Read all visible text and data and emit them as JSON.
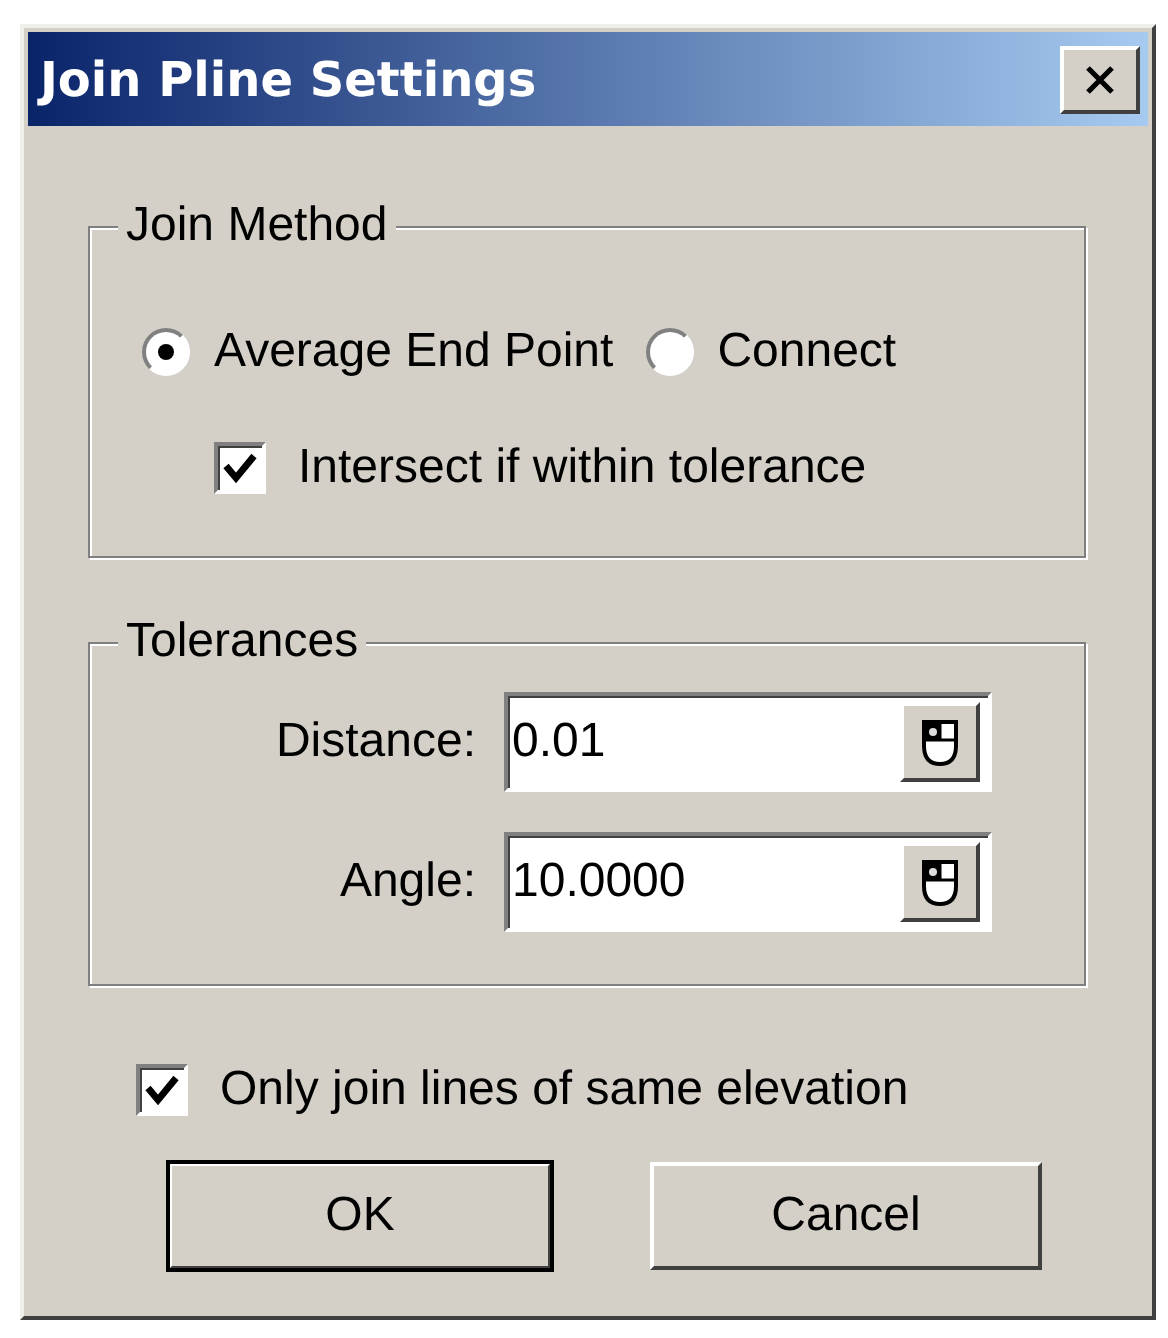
{
  "window": {
    "title": "Join Pline Settings"
  },
  "join_method": {
    "title": "Join Method",
    "options": [
      {
        "label": "Average End Point",
        "selected": true
      },
      {
        "label": "Connect",
        "selected": false
      }
    ],
    "intersect": {
      "label": "Intersect if within tolerance",
      "checked": true
    }
  },
  "tolerances": {
    "title": "Tolerances",
    "fields": [
      {
        "label": "Distance:",
        "value": "0.01"
      },
      {
        "label": "Angle:",
        "value": "10.0000"
      }
    ]
  },
  "same_elevation": {
    "label": "Only join lines of same elevation",
    "checked": true
  },
  "buttons": [
    {
      "label": "OK",
      "default": true
    },
    {
      "label": "Cancel",
      "default": false
    }
  ]
}
